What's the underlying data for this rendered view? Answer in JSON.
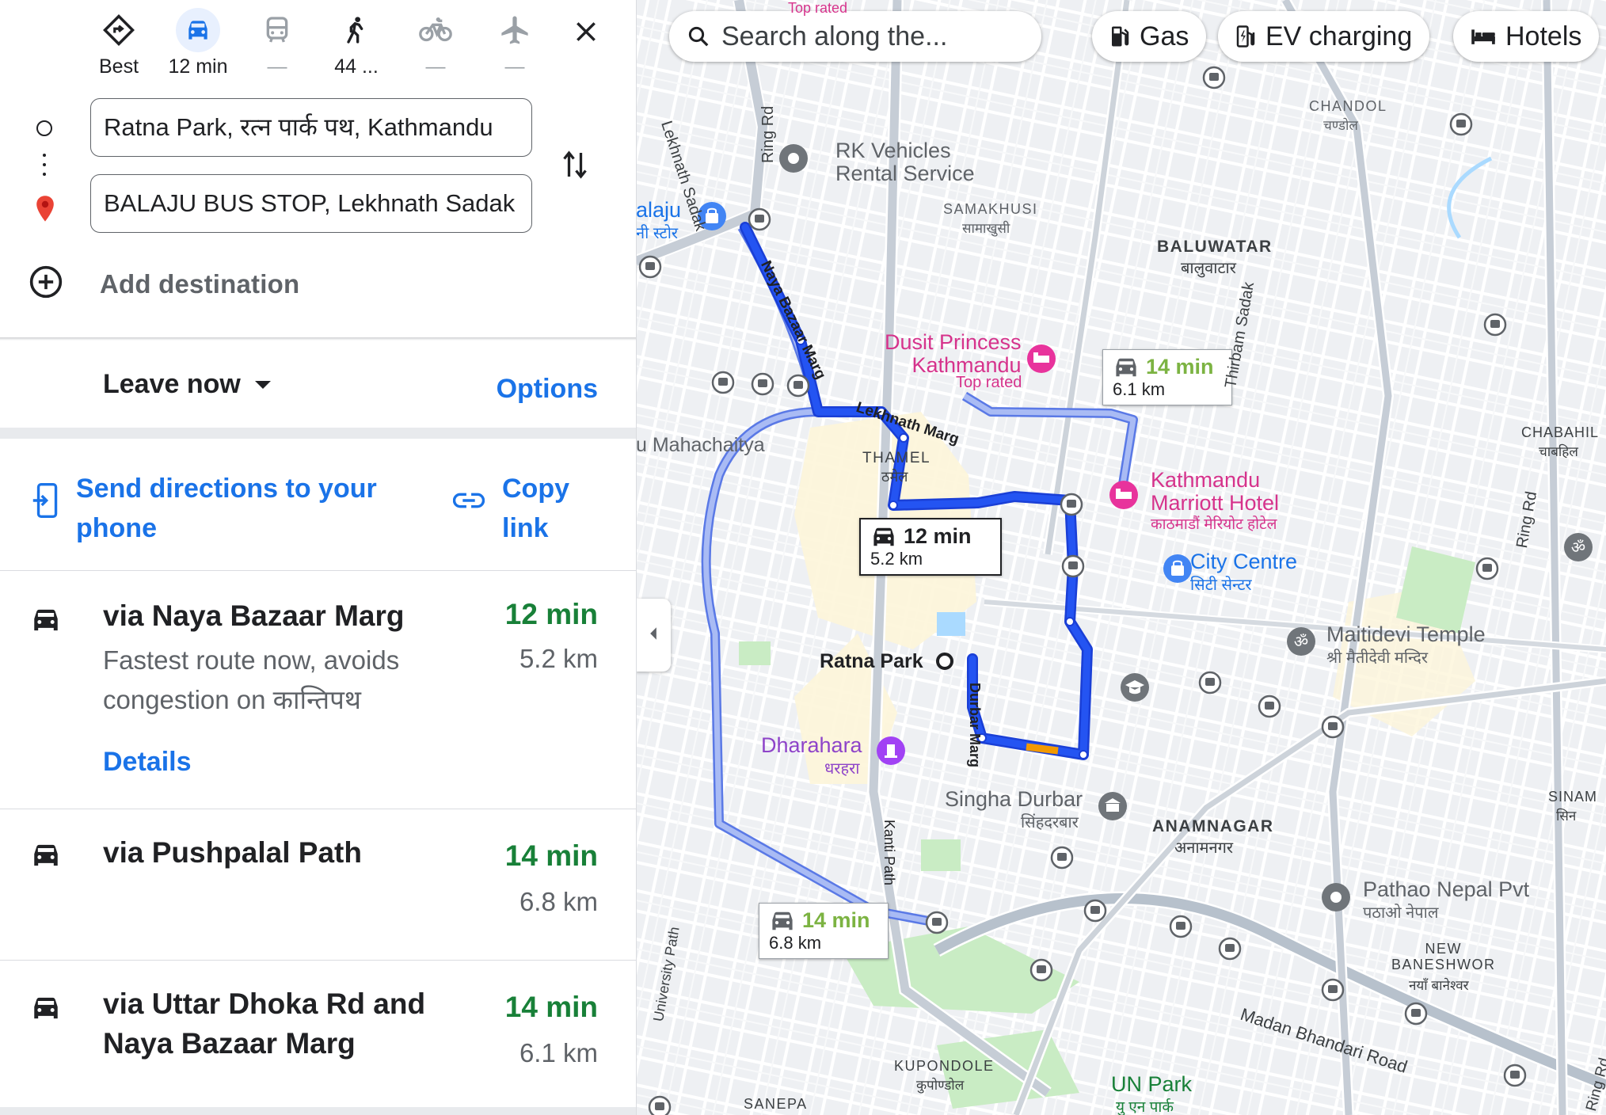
{
  "modes": [
    {
      "label": "Best",
      "icon": "best-route-icon"
    },
    {
      "label": "12 min",
      "icon": "car-icon",
      "selected": true
    },
    {
      "label": "—",
      "icon": "transit-icon"
    },
    {
      "label": "44 ...",
      "icon": "walk-icon"
    },
    {
      "label": "—",
      "icon": "bicycle-icon"
    },
    {
      "label": "—",
      "icon": "flight-icon"
    }
  ],
  "origin": {
    "value": "Ratna Park, रत्न पार्क पथ, Kathmandu"
  },
  "destination": {
    "value": "BALAJU BUS STOP, Lekhnath Sadak"
  },
  "add_destination": "Add destination",
  "leave_now": "Leave now",
  "options": "Options",
  "send_directions": "Send directions to your phone",
  "copy_link": "Copy link",
  "routes": [
    {
      "name": "via Naya Bazaar Marg",
      "time": "12 min",
      "distance": "5.2 km",
      "description": "Fastest route now, avoids congestion on कान्तिपथ",
      "details": "Details"
    },
    {
      "name": "via Pushpalal Path",
      "time": "14 min",
      "distance": "6.8 km"
    },
    {
      "name": "via Uttar Dhoka Rd and Naya Bazaar Marg",
      "time": "14 min",
      "distance": "6.1 km"
    }
  ],
  "map": {
    "search_placeholder": "Search along the...",
    "chips": [
      "Gas",
      "EV charging",
      "Hotels"
    ],
    "route_labels": [
      {
        "time": "12 min",
        "distance": "5.2 km"
      },
      {
        "time": "14 min",
        "distance": "6.1 km"
      },
      {
        "time": "14 min",
        "distance": "6.8 km"
      }
    ],
    "places": {
      "rk": "RK Vehicles\nRental Service",
      "dusit": "Dusit Princess\nKathmandu",
      "dusit_sub": "Top rated",
      "marriott": "Kathmandu\nMarriott Hotel",
      "marriott_np": "काठमाडौं मेरियोट होटेल",
      "city_centre": "City Centre",
      "city_centre_np": "सिटी सेन्टर",
      "maitidevi": "Maitidevi Temple",
      "maitidevi_np": "श्री मैतीदेवी मन्दिर",
      "dharahara": "Dharahara",
      "dharahara_np": "धरहरा",
      "singha": "Singha Durbar",
      "singha_np": "सिंहदरबार",
      "pathao": "Pathao Nepal Pvt",
      "pathao_np": "पठाओ नेपाल",
      "un_park": "UN Park",
      "un_park_np": "यु एन पार्क",
      "ratna_park": "Ratna Park",
      "balaju": "alaju",
      "balaju_np": "नी स्टोर",
      "mahachaitya": "u Mahachaitya"
    },
    "areas": {
      "chandol": "CHANDOL",
      "chandol_np": "चण्डोल",
      "samakhusi": "SAMAKHUSI",
      "samakhusi_np": "सामाखुसी",
      "baluwatar": "BALUWATAR",
      "baluwatar_np": "बालुवाटार",
      "thamel": "THAMEL",
      "thamel_np": "ठमेल",
      "chabahil": "CHABAHIL",
      "chabahil_np": "चाबहिल",
      "anamnagar": "ANAMNAGAR",
      "anamnagar_np": "अनामनगर",
      "new_baneshwor": "NEW\nBANESHWOR",
      "new_baneshwor_np": "नयाँ बानेश्वर",
      "kupondole": "KUPONDOLE",
      "kupondole_np": "कुपोण्डोल",
      "sanepa": "SANEPA",
      "sinam": "SINAM",
      "sinam_np": "सिन"
    },
    "roads": {
      "lekhnath_sadak": "Lekhnath Sadak",
      "ring_rd": "Ring Rd",
      "naya_bazaar": "Naya Bazaar Marg",
      "lekhnath_marg": "Lekhnath Marg",
      "thirbam": "Thirbam Sadak",
      "durbar_marg": "Durbar Marg",
      "kanti_path": "Kanti Path",
      "university_path": "University Path",
      "madan_bhandari": "Madan Bhandari Road",
      "ring_rd_east": "Ring Rd",
      "ring_rd_se": "Ring Rd",
      "top_rated_top": "Top rated"
    }
  }
}
